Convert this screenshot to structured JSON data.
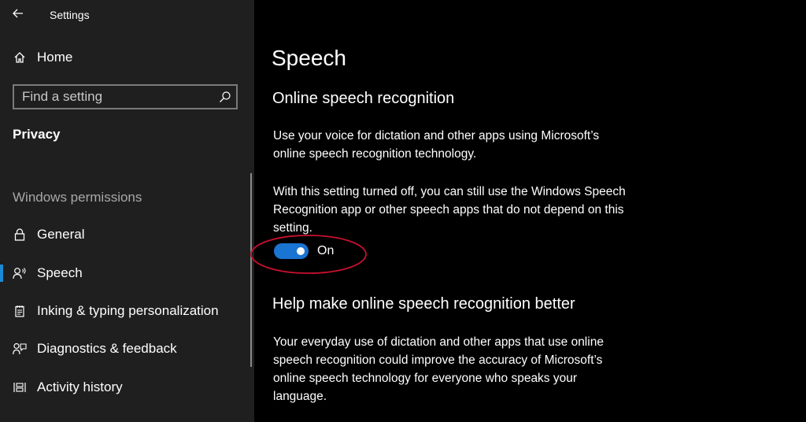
{
  "window": {
    "title": "Settings"
  },
  "sidebar": {
    "home_label": "Home",
    "search": {
      "placeholder": "Find a setting",
      "value": ""
    },
    "section_title": "Privacy",
    "group_header": "Windows permissions",
    "items": [
      {
        "label": "General",
        "icon": "lock-icon"
      },
      {
        "label": "Speech",
        "icon": "speech-icon",
        "selected": true
      },
      {
        "label": "Inking & typing personalization",
        "icon": "notepad-icon"
      },
      {
        "label": "Diagnostics & feedback",
        "icon": "feedback-icon"
      },
      {
        "label": "Activity history",
        "icon": "history-icon"
      }
    ]
  },
  "content": {
    "page_title": "Speech",
    "online_speech": {
      "heading": "Online speech recognition",
      "description": "Use your voice for dictation and other apps using Microsoft’s online speech recognition technology.",
      "note": "With this setting turned off, you can still use the Windows Speech Recognition app or other speech apps that do not depend on this setting.",
      "toggle": {
        "state": "On",
        "is_on": true
      }
    },
    "help_improve": {
      "heading": "Help make online speech recognition better",
      "description": "Your everyday use of dictation and other apps that use online speech recognition could improve the accuracy of Microsoft’s online speech technology for everyone who speaks your language."
    }
  },
  "colors": {
    "accent": "#1a74d2",
    "selection_indicator": "#1a8ad4",
    "annotation": "#c8102e",
    "sidebar_bg": "#1f1f1f",
    "content_bg": "#000000"
  }
}
